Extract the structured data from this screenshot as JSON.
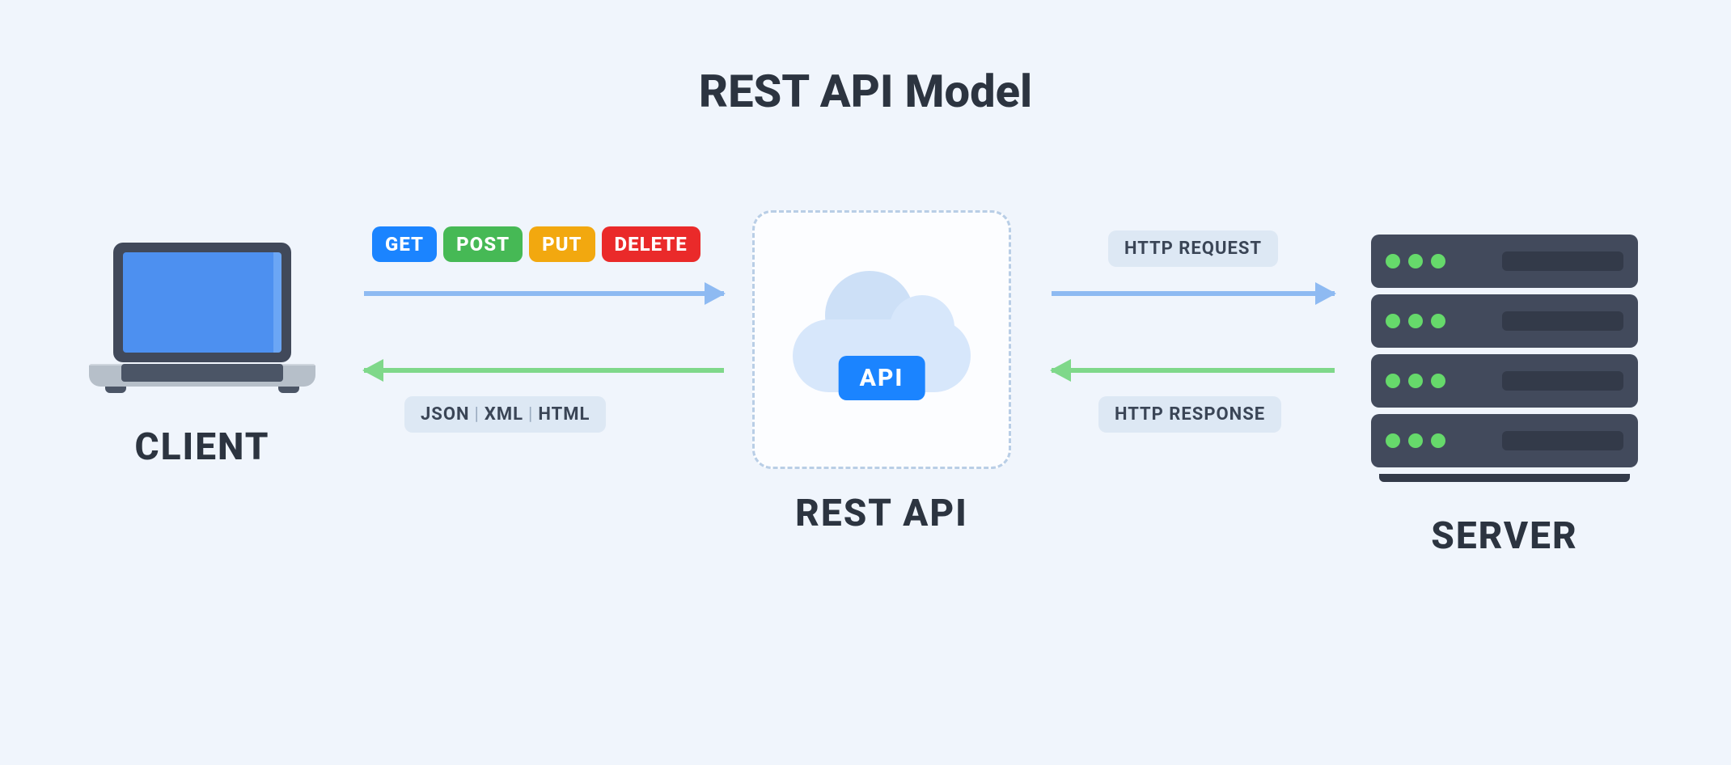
{
  "title": "REST API Model",
  "nodes": {
    "client": "CLIENT",
    "api": "REST API",
    "server": "SERVER"
  },
  "api_badge": "API",
  "http_methods": {
    "get": "GET",
    "post": "POST",
    "put": "PUT",
    "delete": "DELETE"
  },
  "response_formats": [
    "JSON",
    "XML",
    "HTML"
  ],
  "separator": "|",
  "edges": {
    "client_to_api": {
      "direction": "right",
      "labels_above": [
        "GET",
        "POST",
        "PUT",
        "DELETE"
      ],
      "labels_below": "JSON | XML | HTML"
    },
    "api_to_server": {
      "direction": "right",
      "label": "HTTP REQUEST"
    },
    "server_to_api": {
      "direction": "left",
      "label": "HTTP RESPONSE"
    },
    "api_to_client": {
      "direction": "left"
    }
  },
  "tags": {
    "request": "HTTP REQUEST",
    "response": "HTTP RESPONSE"
  }
}
